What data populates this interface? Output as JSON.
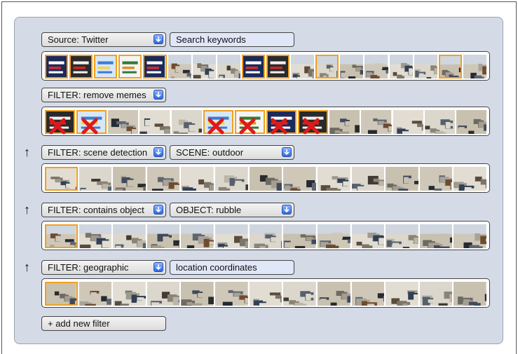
{
  "source_dropdown": {
    "label": "Source: Twitter"
  },
  "search_field": {
    "value": "Search keywords"
  },
  "filters": [
    {
      "label": "FILTER: remove memes"
    },
    {
      "label": "FILTER: scene detection",
      "param_label": "SCENE: outdoor"
    },
    {
      "label": "FILTER: contains object",
      "param_label": "OBJECT: rubble"
    },
    {
      "label": "FILTER: geographic",
      "param_text": "location coordinates"
    }
  ],
  "add_filter": {
    "label": "+ add new filter"
  },
  "reorder_icon": "↑",
  "colors": {
    "panel": "#d4dbe7",
    "highlight": "#f0a020",
    "reject_mark": "#e01818",
    "dropdown_button": "#2d6ae0"
  },
  "strips": [
    {
      "name": "source-results",
      "count": 18,
      "memes": [
        0,
        1,
        2,
        3,
        4,
        8,
        9
      ],
      "highlighted": [
        0,
        1,
        2,
        3,
        4,
        8,
        9,
        11,
        16
      ]
    },
    {
      "name": "meme-filter-results",
      "count": 14,
      "highlighted": [
        0,
        1,
        5,
        6,
        7,
        8
      ],
      "rejected": [
        0,
        1,
        5,
        6,
        7,
        8
      ]
    },
    {
      "name": "scene-filter-results",
      "count": 13,
      "highlighted": [
        0
      ]
    },
    {
      "name": "object-filter-results",
      "count": 13,
      "highlighted": [
        0
      ]
    },
    {
      "name": "geo-filter-results",
      "count": 13,
      "highlighted": [
        0
      ]
    }
  ]
}
